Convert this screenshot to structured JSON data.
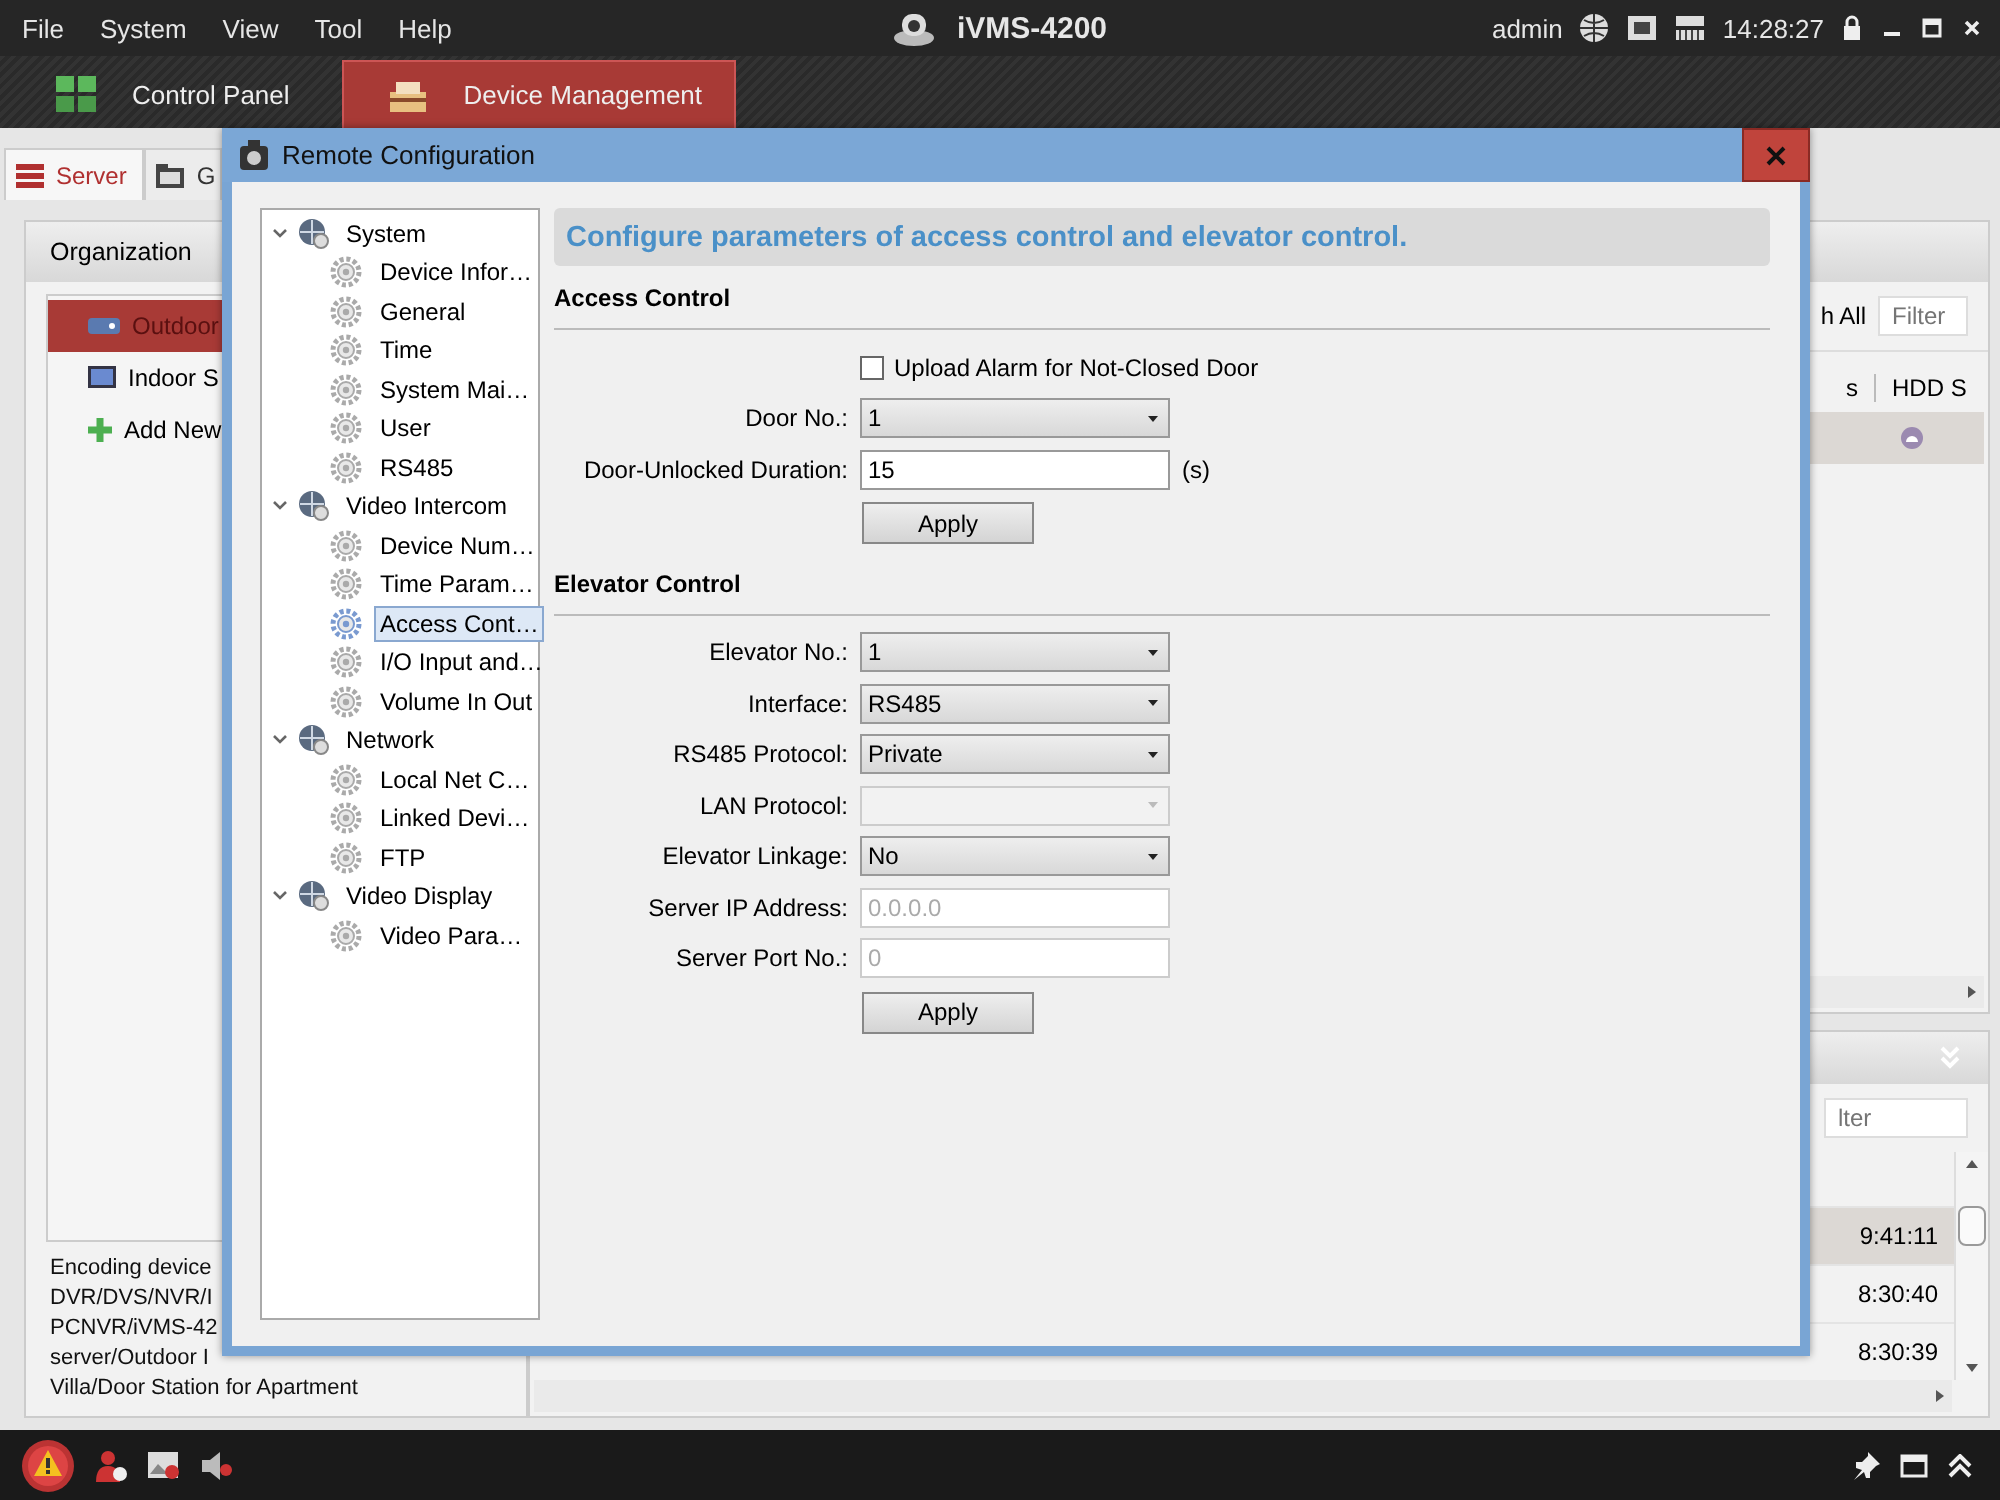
{
  "menu_bar": {
    "items": [
      "File",
      "System",
      "View",
      "Tool",
      "Help"
    ],
    "app_title": "iVMS-4200",
    "user": "admin",
    "time": "14:28:27"
  },
  "main_tabs": [
    {
      "label": "Control Panel",
      "selected": false
    },
    {
      "label": "Device Management",
      "selected": true
    }
  ],
  "sub_tabs": [
    {
      "label": "Server",
      "selected": true
    },
    {
      "label": "G",
      "selected": false
    }
  ],
  "organization": {
    "title": "Organization",
    "items": [
      {
        "label": "Outdoor",
        "selected": true,
        "kind": "device"
      },
      {
        "label": "Indoor S",
        "selected": false,
        "kind": "screen"
      },
      {
        "label": "Add New",
        "selected": false,
        "kind": "add"
      }
    ],
    "description_lines": [
      "Encoding device",
      "DVR/DVS/NVR/I",
      "PCNVR/iVMS-42",
      "server/Outdoor I",
      "Villa/Door Station for Apartment"
    ]
  },
  "device_panel": {
    "search_label": "h All",
    "filter_placeholder": "Filter",
    "columns": [
      "s",
      "HDD S"
    ]
  },
  "log_panel": {
    "filter_placeholder": "lter",
    "rows": [
      {
        "time": "9:41:11",
        "selected": true
      },
      {
        "time": "8:30:40",
        "selected": false
      },
      {
        "time": "8:30:39",
        "selected": false
      }
    ]
  },
  "dialog": {
    "title": "Remote Configuration",
    "tree": [
      {
        "label": "System",
        "expanded": true,
        "selected": false,
        "children": [
          {
            "label": "Device Infor…",
            "selected": false
          },
          {
            "label": "General",
            "selected": false
          },
          {
            "label": "Time",
            "selected": false
          },
          {
            "label": "System Mai…",
            "selected": false
          },
          {
            "label": "User",
            "selected": false
          },
          {
            "label": "RS485",
            "selected": false
          }
        ]
      },
      {
        "label": "Video Intercom",
        "expanded": true,
        "selected": false,
        "children": [
          {
            "label": "Device Num…",
            "selected": false
          },
          {
            "label": "Time Param…",
            "selected": false
          },
          {
            "label": "Access Cont…",
            "selected": true
          },
          {
            "label": "I/O Input and…",
            "selected": false
          },
          {
            "label": "Volume In Out",
            "selected": false
          }
        ]
      },
      {
        "label": "Network",
        "expanded": true,
        "selected": false,
        "children": [
          {
            "label": "Local Net C…",
            "selected": false
          },
          {
            "label": "Linked Devi…",
            "selected": false
          },
          {
            "label": "FTP",
            "selected": false
          }
        ]
      },
      {
        "label": "Video Display",
        "expanded": true,
        "selected": false,
        "children": [
          {
            "label": "Video Para…",
            "selected": false
          }
        ]
      }
    ],
    "heading": "Configure parameters of access control and elevator control.",
    "sections": [
      {
        "title": "Access Control",
        "fields": [
          {
            "kind": "checkbox",
            "label": "Upload Alarm for Not-Closed Door",
            "checked": false
          },
          {
            "kind": "select",
            "label": "Door No.:",
            "value": "1",
            "disabled": false
          },
          {
            "kind": "text",
            "label": "Door-Unlocked Duration:",
            "value": "15",
            "unit": "(s)",
            "disabled": false
          },
          {
            "kind": "button",
            "label": "Apply"
          }
        ]
      },
      {
        "title": "Elevator Control",
        "fields": [
          {
            "kind": "select",
            "label": "Elevator No.:",
            "value": "1",
            "disabled": false
          },
          {
            "kind": "select",
            "label": "Interface:",
            "value": "RS485",
            "disabled": false
          },
          {
            "kind": "select",
            "label": "RS485 Protocol:",
            "value": "Private",
            "disabled": false
          },
          {
            "kind": "select",
            "label": "LAN Protocol:",
            "disabled": true
          },
          {
            "kind": "select",
            "label": "Elevator Linkage:",
            "value": "No",
            "disabled": false
          },
          {
            "kind": "text",
            "label": "Server IP Address:",
            "value": "0.0.0.0",
            "disabled": true
          },
          {
            "kind": "text",
            "label": "Server Port No.:",
            "value": "0",
            "disabled": true
          },
          {
            "kind": "button",
            "label": "Apply"
          }
        ]
      }
    ]
  }
}
